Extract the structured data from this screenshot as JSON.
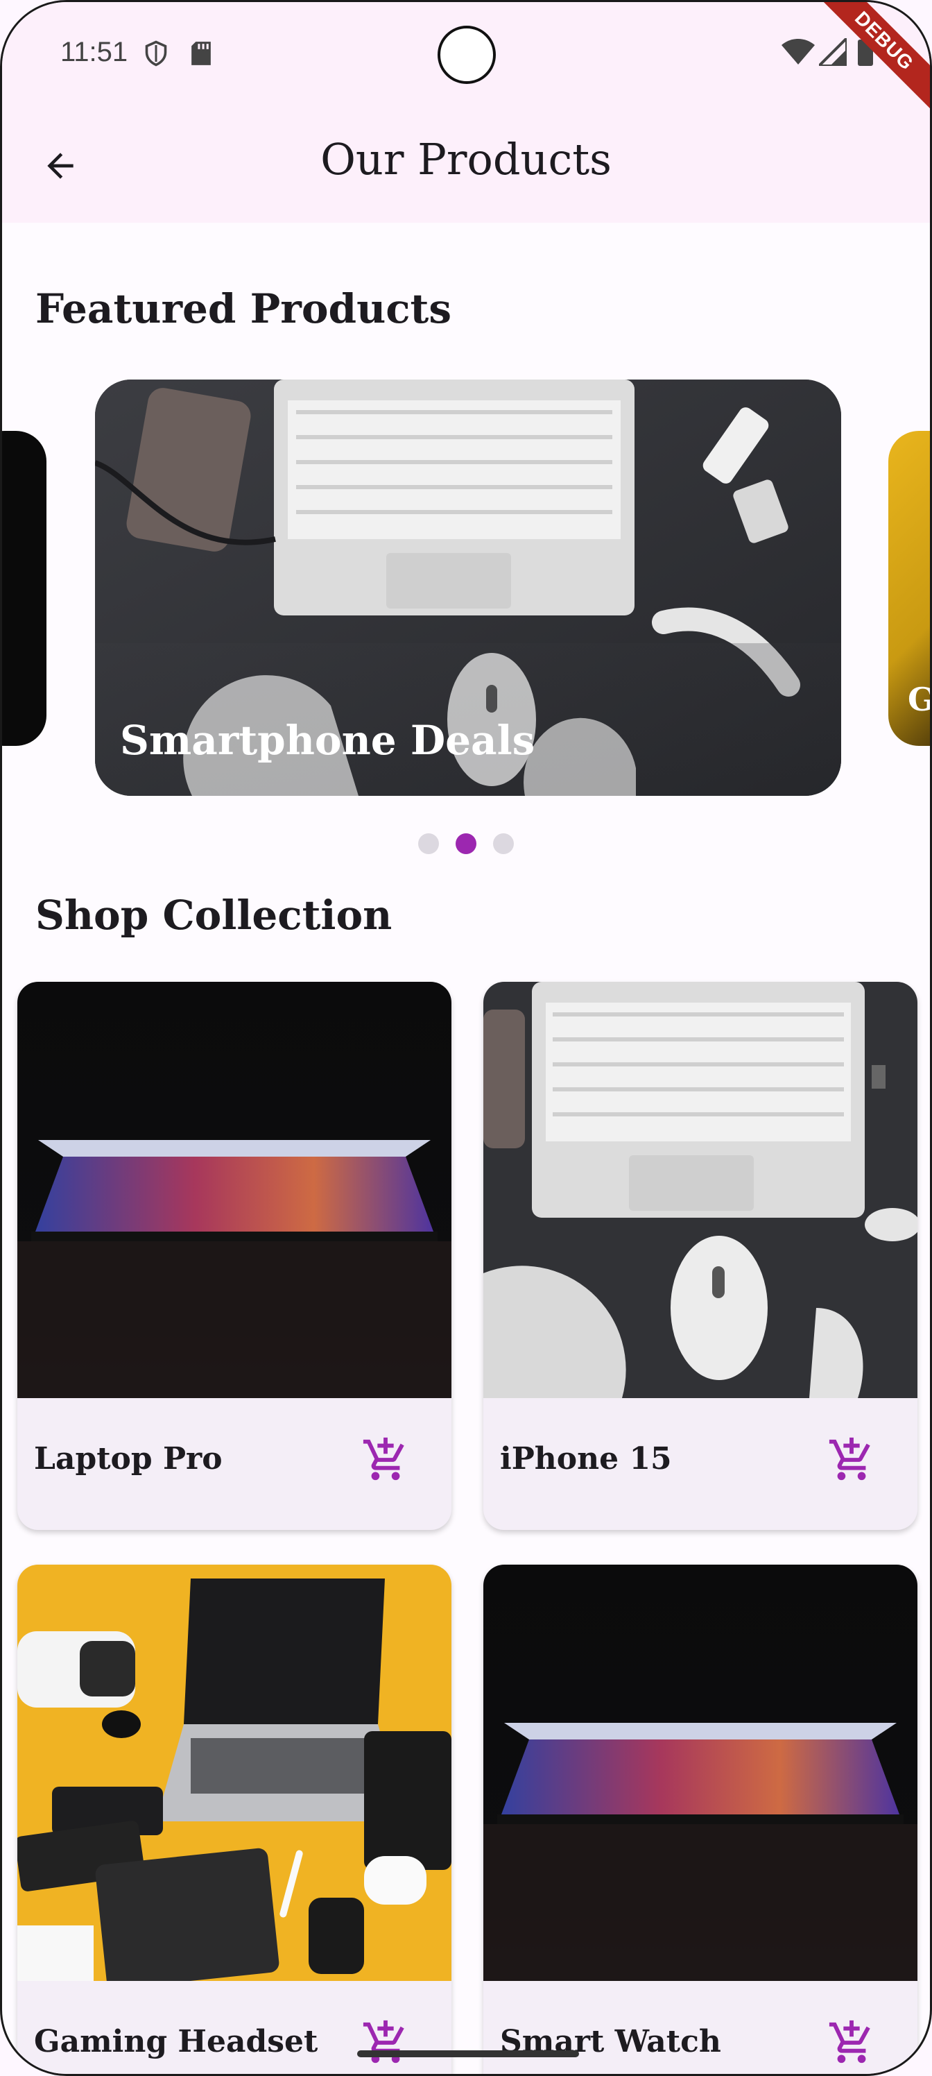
{
  "status_bar": {
    "time": "11:51",
    "debug_banner": "DEBUG"
  },
  "app_bar": {
    "title": "Our Products",
    "back_icon": "arrow-back-icon"
  },
  "featured": {
    "heading": "Featured Products",
    "slides": [
      {
        "label": ""
      },
      {
        "label": "Smartphone Deals"
      },
      {
        "label": "G"
      }
    ],
    "active_index": 1
  },
  "collection": {
    "heading": "Shop Collection",
    "products": [
      {
        "name": "Laptop Pro"
      },
      {
        "name": "iPhone 15"
      },
      {
        "name": "Gaming Headset"
      },
      {
        "name": "Smart Watch"
      }
    ],
    "cart_icon": "add-shopping-cart-icon"
  },
  "colors": {
    "accent": "#9c27b0",
    "app_bar_bg": "#fdf0fb",
    "card_bg": "#f4eef7"
  }
}
